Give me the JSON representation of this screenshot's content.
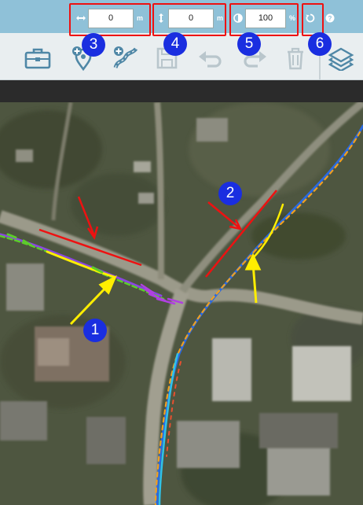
{
  "toolbar": {
    "fields": {
      "horizontal": {
        "value": "0",
        "unit": "m",
        "icon": "horizontal-arrows-icon"
      },
      "vertical": {
        "value": "0",
        "unit": "m",
        "icon": "vertical-arrows-icon"
      },
      "opacity": {
        "value": "100",
        "unit": "%",
        "icon": "opacity-icon"
      }
    },
    "buttons": [
      {
        "icon": "briefcase-icon"
      },
      {
        "icon": "add-location-icon"
      },
      {
        "icon": "add-route-icon"
      },
      {
        "icon": "save-icon",
        "disabled": true
      },
      {
        "icon": "undo-icon",
        "disabled": true
      },
      {
        "icon": "redo-icon",
        "disabled": true
      },
      {
        "icon": "trash-icon",
        "disabled": true
      },
      {
        "icon": "layers-icon"
      }
    ],
    "reset_icon": "reset-icon",
    "help_icon": "help-icon"
  },
  "annotations": {
    "badges": [
      "1",
      "2",
      "3",
      "4",
      "5",
      "6"
    ]
  },
  "colors": {
    "topbar": "#8fc1d8",
    "toolbar": "#e9eef0",
    "icon": "#4f87a6",
    "icon_disabled": "#b9c6cc",
    "annotation_red": "#ee1111",
    "annotation_yellow": "#ffee00",
    "badge_blue": "#1a2ee0"
  }
}
